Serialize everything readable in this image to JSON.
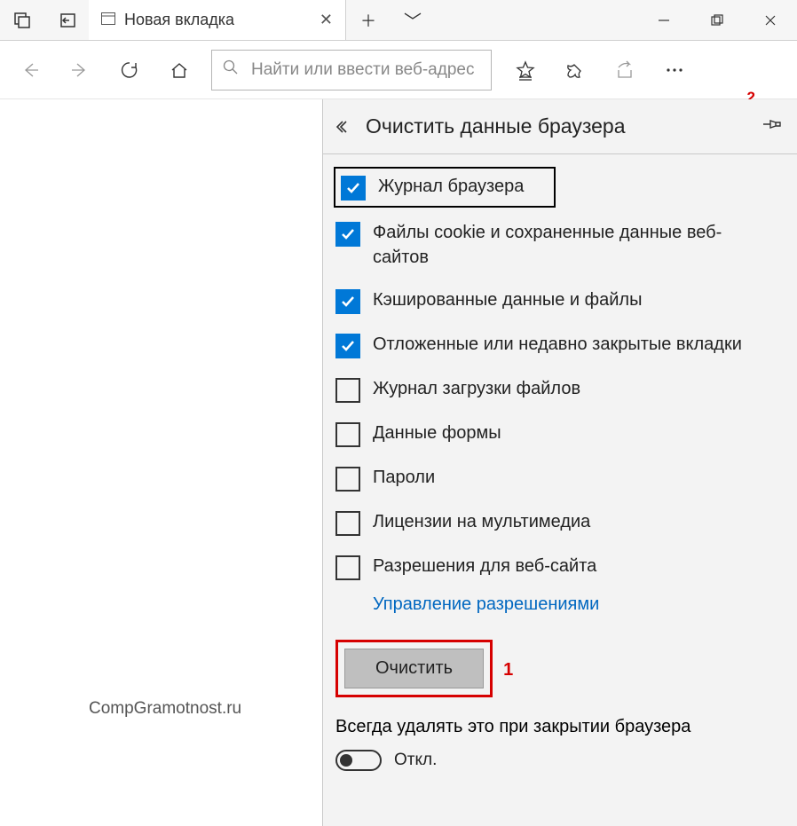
{
  "titlebar": {
    "tab_title": "Новая вкладка"
  },
  "toolbar": {
    "address_placeholder": "Найти или ввести веб-адрес"
  },
  "annotations": {
    "marker1": "1",
    "marker2": "2"
  },
  "panel": {
    "title": "Очистить данные браузера",
    "options": [
      {
        "label": "Журнал браузера",
        "checked": true,
        "highlight": true
      },
      {
        "label": "Файлы cookie и сохраненные данные веб-сайтов",
        "checked": true,
        "highlight": false
      },
      {
        "label": "Кэшированные данные и файлы",
        "checked": true,
        "highlight": false
      },
      {
        "label": "Отложенные или недавно закрытые вкладки",
        "checked": true,
        "highlight": false
      },
      {
        "label": "Журнал загрузки файлов",
        "checked": false,
        "highlight": false
      },
      {
        "label": "Данные формы",
        "checked": false,
        "highlight": false
      },
      {
        "label": "Пароли",
        "checked": false,
        "highlight": false
      },
      {
        "label": "Лицензии на мультимедиа",
        "checked": false,
        "highlight": false
      },
      {
        "label": "Разрешения для веб-сайта",
        "checked": false,
        "highlight": false
      }
    ],
    "manage_permissions_link": "Управление разрешениями",
    "clear_button": "Очистить",
    "always_clear_label": "Всегда удалять это при закрытии браузера",
    "toggle_state": "Откл."
  },
  "watermark": "CompGramotnost.ru"
}
